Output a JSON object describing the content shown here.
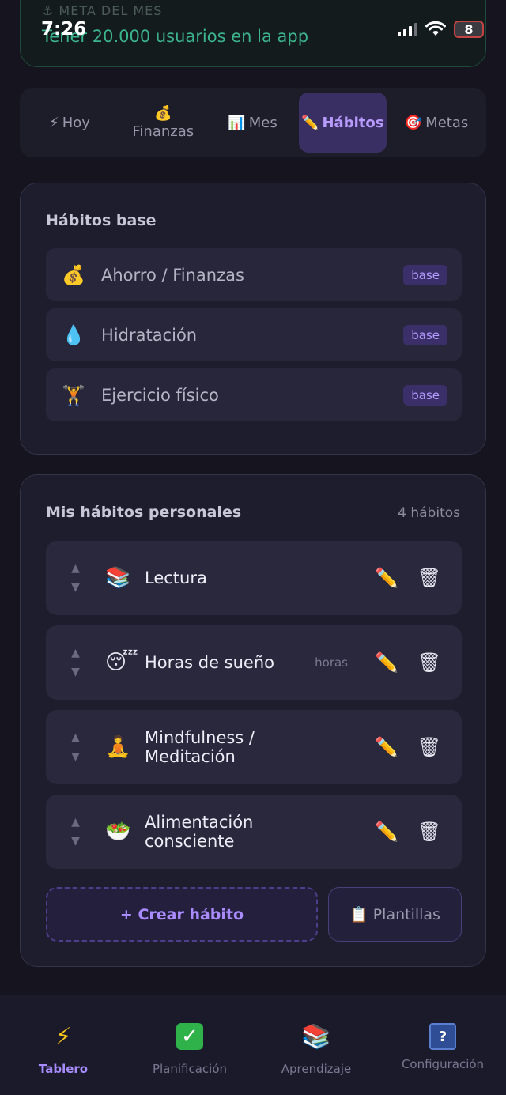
{
  "status_bar": {
    "time": "7:26",
    "battery": "8"
  },
  "meta": {
    "label": "⚓ META DEL MES",
    "text": "Tener 20.000 usuarios en la app"
  },
  "tabs": [
    {
      "icon": "⚡",
      "label": "Hoy"
    },
    {
      "icon": "💰",
      "label": "Finanzas"
    },
    {
      "icon": "📊",
      "label": "Mes"
    },
    {
      "icon": "✏️",
      "label": "Hábitos"
    },
    {
      "icon": "🎯",
      "label": "Metas"
    }
  ],
  "base_section": {
    "title": "Hábitos base",
    "items": [
      {
        "icon": "💰",
        "label": "Ahorro / Finanzas",
        "badge": "base"
      },
      {
        "icon": "💧",
        "label": "Hidratación",
        "badge": "base"
      },
      {
        "icon": "🏋",
        "label": "Ejercicio físico",
        "badge": "base"
      }
    ]
  },
  "personal_section": {
    "title": "Mis hábitos personales",
    "count": "4 hábitos",
    "items": [
      {
        "icon": "📚",
        "label": "Lectura",
        "unit": ""
      },
      {
        "icon": "😴",
        "label": "Horas de sueño",
        "unit": "horas"
      },
      {
        "icon": "🧘",
        "label": "Mindfulness / Meditación",
        "unit": ""
      },
      {
        "icon": "🥗",
        "label": "Alimentación consciente",
        "unit": ""
      }
    ],
    "create_label": "+ Crear hábito",
    "templates_icon": "📋",
    "templates_label": "Plantillas"
  },
  "bottom_nav": [
    {
      "icon": "⚡",
      "label": "Tablero",
      "active": true
    },
    {
      "icon": "✓",
      "label": "Planificación"
    },
    {
      "icon": "📚",
      "label": "Aprendizaje"
    },
    {
      "icon": "?",
      "label": "Configuración"
    }
  ],
  "colors": {
    "accent": "#a68cff",
    "meta_text": "#3bb38b",
    "background": "#15141f"
  }
}
